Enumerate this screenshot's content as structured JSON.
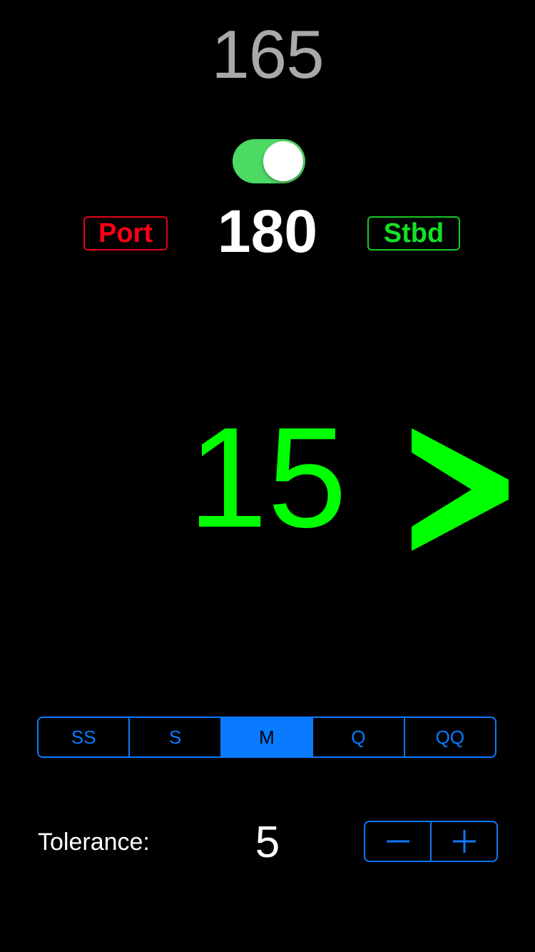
{
  "heading_value": "165",
  "toggle": {
    "state": "on",
    "on_color": "#4cd964"
  },
  "port_label": "Port",
  "target_value": "180",
  "stbd_label": "Stbd",
  "offset_value": "15",
  "direction_indicator": {
    "icon": "chevron-right-icon",
    "color": "#00ff00"
  },
  "speed_segments": {
    "items": [
      "SS",
      "S",
      "M",
      "Q",
      "QQ"
    ],
    "selected": "M"
  },
  "tolerance": {
    "label": "Tolerance:",
    "value": "5",
    "decrement_icon": "minus-icon",
    "increment_icon": "plus-icon"
  },
  "colors": {
    "accent": "#0a7aff",
    "port": "#ff0016",
    "stbd": "#14e027",
    "offset": "#00ff00"
  }
}
